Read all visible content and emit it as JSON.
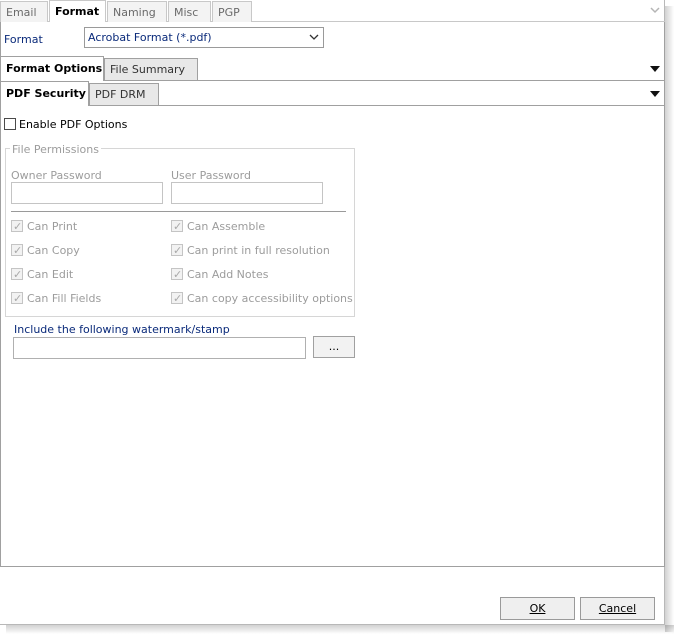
{
  "top_tabs": [
    {
      "label": "Email",
      "active": false
    },
    {
      "label": "Format",
      "active": true
    },
    {
      "label": "Naming",
      "active": false
    },
    {
      "label": "Misc",
      "active": false
    },
    {
      "label": "PGP",
      "active": false
    }
  ],
  "format": {
    "label": "Format",
    "selected": "Acrobat Format (*.pdf)"
  },
  "option_tabs": [
    {
      "label": "Format Options",
      "active": true
    },
    {
      "label": "File Summary",
      "active": false
    }
  ],
  "security_tabs": [
    {
      "label": "PDF Security",
      "active": true
    },
    {
      "label": "PDF DRM",
      "active": false
    }
  ],
  "enable_pdf_options": {
    "label": "Enable PDF Options",
    "checked": false
  },
  "file_permissions": {
    "legend": "File Permissions",
    "owner_password_label": "Owner Password",
    "owner_password_value": "",
    "user_password_label": "User Password",
    "user_password_value": "",
    "permissions_left": [
      {
        "label": "Can Print",
        "checked": true
      },
      {
        "label": "Can Copy",
        "checked": true
      },
      {
        "label": "Can Edit",
        "checked": true
      },
      {
        "label": "Can Fill Fields",
        "checked": true
      }
    ],
    "permissions_right": [
      {
        "label": "Can Assemble",
        "checked": true
      },
      {
        "label": "Can print in full resolution",
        "checked": true
      },
      {
        "label": "Can Add Notes",
        "checked": true
      },
      {
        "label": "Can copy accessibility options",
        "checked": true
      }
    ]
  },
  "watermark": {
    "label": "Include the following watermark/stamp",
    "value": "",
    "browse_label": "..."
  },
  "footer": {
    "ok_label": "OK",
    "cancel_label": "Cancel"
  },
  "colors": {
    "label_blue": "#0a2a7a",
    "disabled_grey": "#9c9c9c"
  }
}
